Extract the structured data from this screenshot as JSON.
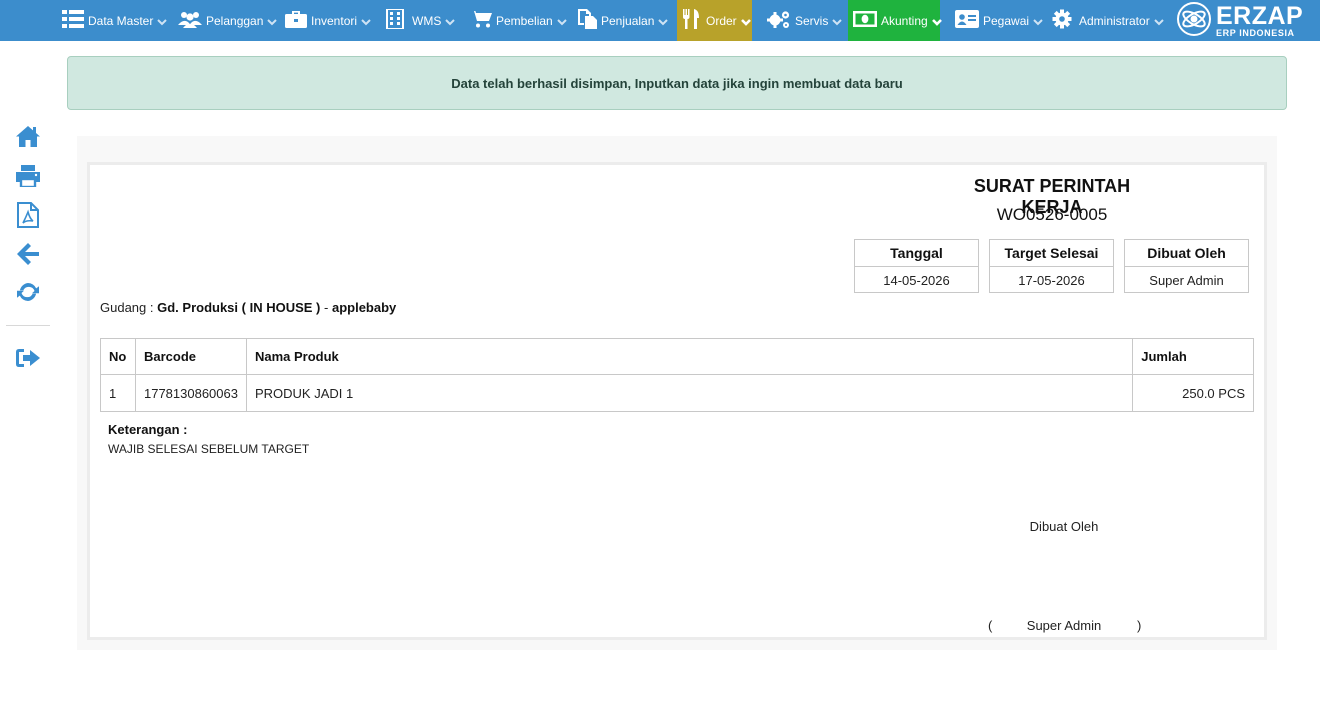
{
  "nav": {
    "items": [
      {
        "label": "Data Master",
        "icon": "list-icon"
      },
      {
        "label": "Pelanggan",
        "icon": "users-icon"
      },
      {
        "label": "Inventori",
        "icon": "briefcase-icon"
      },
      {
        "label": "WMS",
        "icon": "building-icon"
      },
      {
        "label": "Pembelian",
        "icon": "cart-icon"
      },
      {
        "label": "Penjualan",
        "icon": "files-icon"
      },
      {
        "label": "Order",
        "icon": "cutlery-icon",
        "color": "#b8a22a"
      },
      {
        "label": "Servis",
        "icon": "gears-icon"
      },
      {
        "label": "Akunting",
        "icon": "money-icon",
        "color": "#1fb33e"
      },
      {
        "label": "Pegawai",
        "icon": "id-card-icon"
      },
      {
        "label": "Administrator",
        "icon": "gear-icon"
      }
    ],
    "bar_color": "#3c8dcc"
  },
  "brand": {
    "name": "ERZAP",
    "subtitle": "ERP INDONESIA"
  },
  "alert": {
    "message": "Data telah berhasil disimpan, Inputkan data jika ingin membuat data baru"
  },
  "sidebar": {
    "icons": [
      "home-icon",
      "print-icon",
      "pdf-icon",
      "arrow-left-icon",
      "refresh-icon",
      "sign-out-icon"
    ],
    "icon_color": "#3a8ed0"
  },
  "document": {
    "title": "SURAT PERINTAH KERJA",
    "number": "WO0526-0005",
    "info": [
      {
        "label": "Tanggal",
        "value": "14-05-2026"
      },
      {
        "label": "Target Selesai",
        "value": "17-05-2026"
      },
      {
        "label": "Dibuat Oleh",
        "value": "Super Admin"
      }
    ],
    "gudang_label": "Gudang :",
    "gudang_value": "Gd. Produksi ( IN HOUSE )",
    "gudang_separator": "-",
    "gudang_owner": "applebaby",
    "table": {
      "headers": {
        "no": "No",
        "barcode": "Barcode",
        "product": "Nama Produk",
        "qty": "Jumlah"
      },
      "rows": [
        {
          "no": "1",
          "barcode": "1778130860063",
          "product": "PRODUK JADI 1",
          "qty": "250.0 PCS"
        }
      ]
    },
    "keterangan_label": "Keterangan :",
    "keterangan_text": "WAJIB SELESAI SEBELUM TARGET",
    "sign": {
      "label": "Dibuat Oleh",
      "open": "(",
      "name": "Super Admin",
      "close": ")"
    }
  }
}
